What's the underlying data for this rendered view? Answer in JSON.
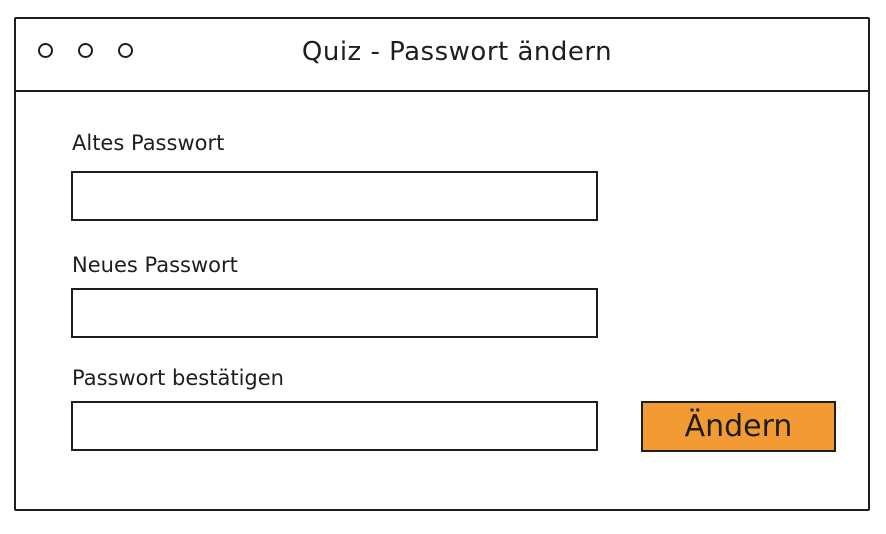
{
  "window": {
    "title": "Quiz - Passwort ändern"
  },
  "form": {
    "old_password_label": "Altes Passwort",
    "old_password_value": "",
    "new_password_label": "Neues Passwort",
    "new_password_value": "",
    "confirm_password_label": "Passwort bestätigen",
    "confirm_password_value": "",
    "submit_label": "Ändern"
  },
  "colors": {
    "accent": "#f29a33",
    "stroke": "#1e1e1e",
    "background": "#ffffff"
  }
}
